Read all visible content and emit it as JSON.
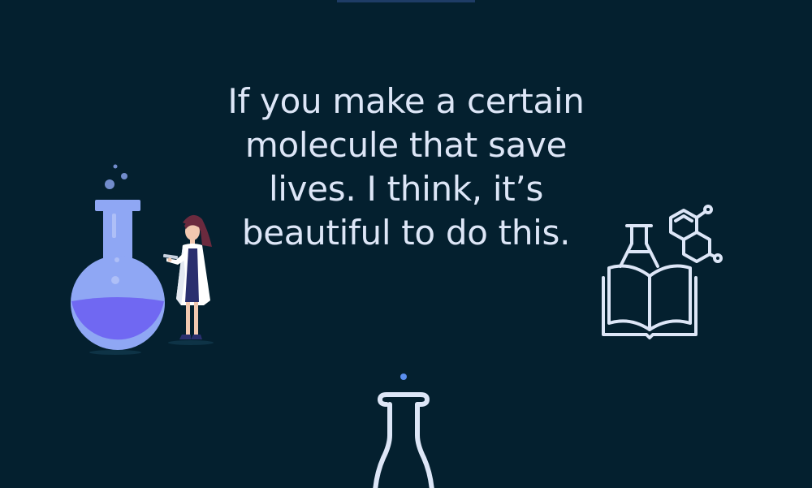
{
  "slide": {
    "quote": "If you make a certain molecule that save lives. I think, it’s beautiful to do this.",
    "colors": {
      "background": "#04202f",
      "text": "#dde6f7",
      "flask_glass": "#8fa7f4",
      "flask_liquid": "#7068f2",
      "line_art": "#dde6f7",
      "accent_dot": "#5b8ff0"
    },
    "icons": [
      "round-bottom-flask-icon",
      "scientist-woman-illustration",
      "book-flask-molecule-icon",
      "erlenmeyer-flask-icon"
    ]
  }
}
